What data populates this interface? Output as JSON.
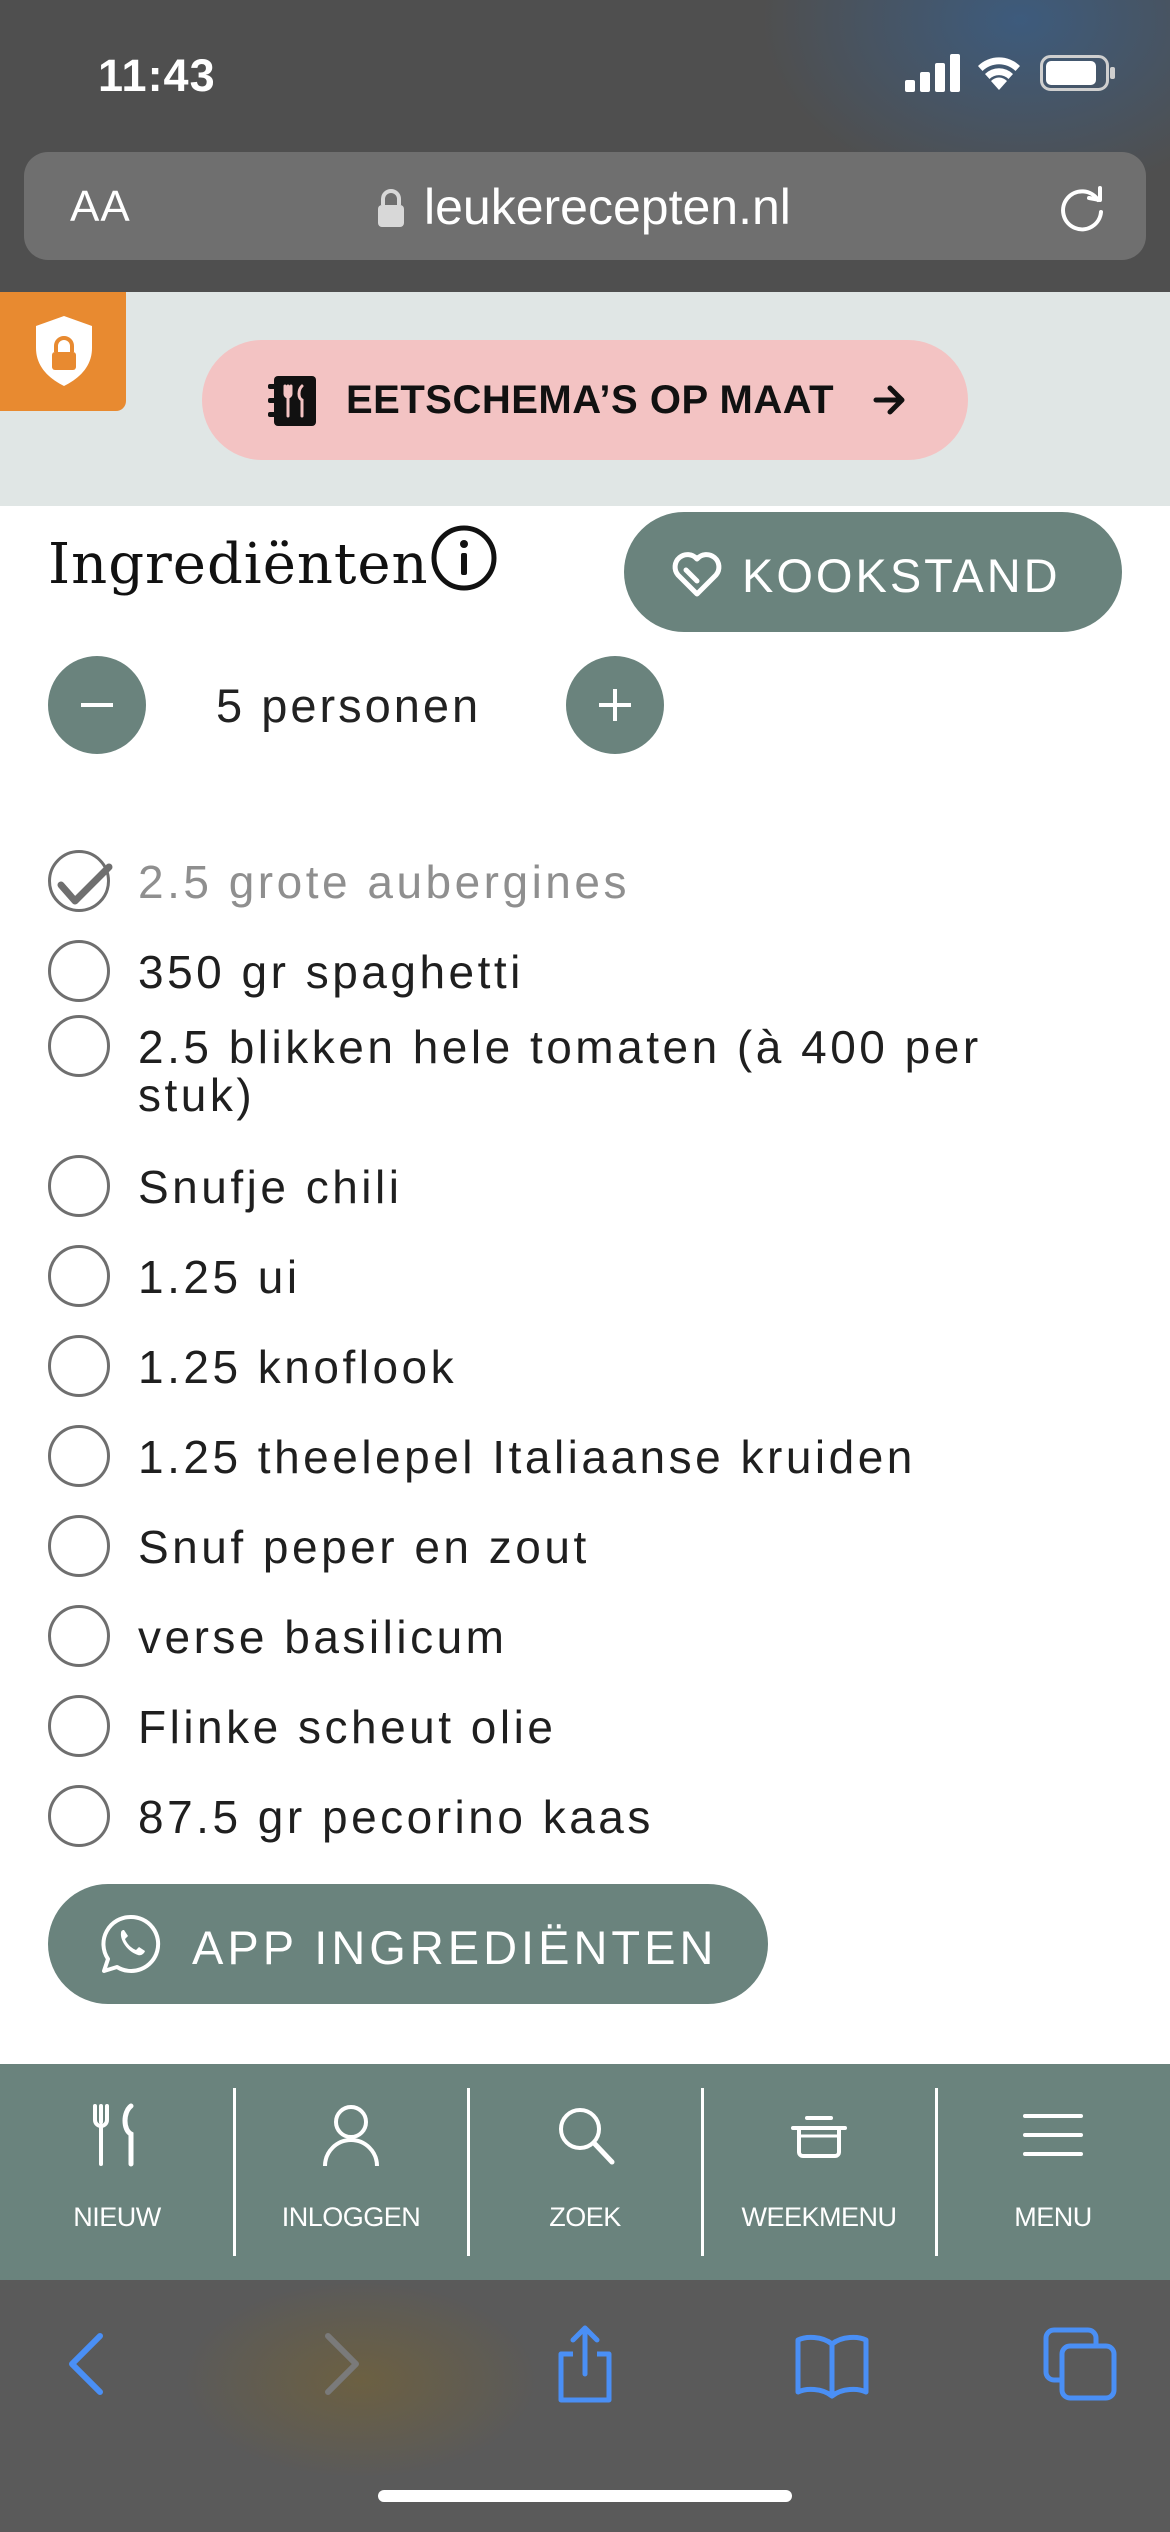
{
  "status_bar": {
    "time": "11:43"
  },
  "browser": {
    "text_size_label": "AA",
    "url": "leukerecepten.nl"
  },
  "promo": {
    "label": "EETSCHEMA’S OP MAAT"
  },
  "ingredients": {
    "title": "Ingrediënten",
    "cook_mode_label": "KOOKSTAND",
    "servings_label": "5 personen",
    "items": [
      {
        "text": "2.5 grote aubergines",
        "checked": true
      },
      {
        "text": "350 gr spaghetti",
        "checked": false
      },
      {
        "text": "2.5 blikken hele tomaten (à 400 per stuk)",
        "checked": false
      },
      {
        "text": "Snufje chili",
        "checked": false
      },
      {
        "text": "1.25 ui",
        "checked": false
      },
      {
        "text": "1.25 knoflook",
        "checked": false
      },
      {
        "text": "1.25 theelepel Italiaanse kruiden",
        "checked": false
      },
      {
        "text": "Snuf peper en zout",
        "checked": false
      },
      {
        "text": "verse basilicum",
        "checked": false
      },
      {
        "text": "Flinke scheut olie",
        "checked": false
      },
      {
        "text": "87.5 gr pecorino kaas",
        "checked": false
      }
    ],
    "whatsapp_label": "APP INGREDIËNTEN"
  },
  "site_nav": {
    "items": [
      {
        "label": "NIEUW",
        "icon": "fork-knife-icon"
      },
      {
        "label": "INLOGGEN",
        "icon": "user-icon"
      },
      {
        "label": "ZOEK",
        "icon": "search-icon"
      },
      {
        "label": "WEEKMENU",
        "icon": "cooking-pot-icon"
      },
      {
        "label": "MENU",
        "icon": "hamburger-icon"
      }
    ]
  },
  "colors": {
    "accent_green": "#6a837d",
    "promo_pink": "#f3c3c3",
    "promo_band": "#e0e6e5",
    "shield_orange": "#e88a30",
    "safari_blue": "#4a8ff5"
  }
}
